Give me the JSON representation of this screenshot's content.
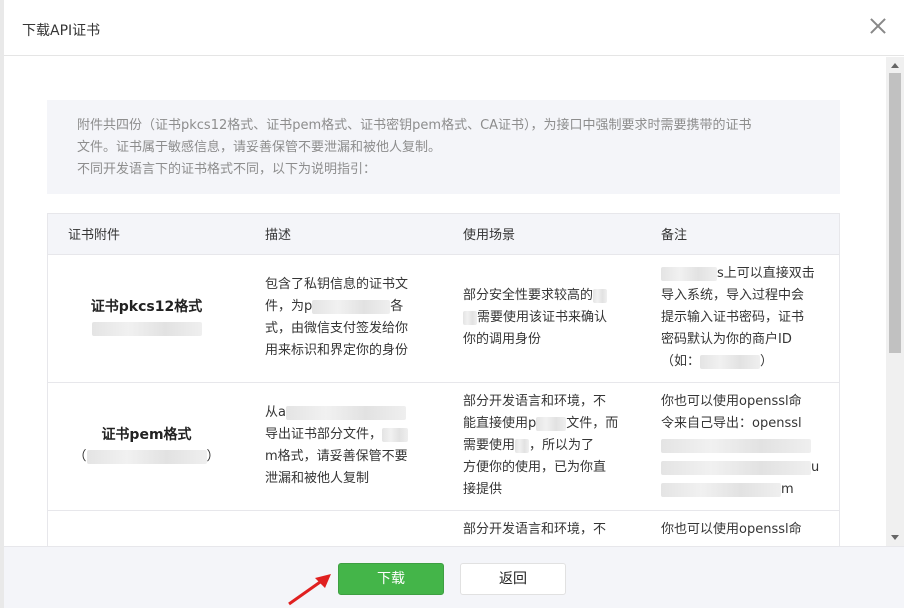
{
  "dialog": {
    "title": "下载API证书",
    "notice": {
      "line1": "附件共四份（证书pkcs12格式、证书pem格式、证书密钥pem格式、CA证书），为接口中强制要求时需要携带的证书",
      "line2": "文件。证书属于敏感信息，请妥善保管不要泄漏和被他人复制。",
      "line3": "不同开发语言下的证书格式不同，以下为说明指引："
    },
    "table": {
      "headers": [
        "证书附件",
        "描述",
        "使用场景",
        "备注"
      ],
      "rows": [
        {
          "name": "证书pkcs12格式",
          "desc": [
            "包含了私钥信息的证书文",
            "件，为p",
            "式，由微信支付签发给你",
            "用来标识和界定你的身份"
          ],
          "scene": [
            "部分安全性要求较高的",
            "需要使用该证书来确认",
            "你的调用身份"
          ],
          "note": [
            "s上可以直接双击",
            "导入系统，导入过程中会",
            "提示输入证书密码，证书",
            "密码默认为你的商户ID",
            "（如："
          ]
        },
        {
          "name": "证书pem格式",
          "desc": [
            "从a",
            "导出证书部分文件，",
            "m格式，请妥善保管不要",
            "泄漏和被他人复制"
          ],
          "scene": [
            "部分开发语言和环境，不",
            "能直接使用p",
            "文件，而",
            "需要使用",
            "，所以为了",
            "方便你的使用，已为你直",
            "接提供"
          ],
          "note": [
            "你也可以使用openssl命",
            "令来自己导出：openssl",
            "u",
            "m"
          ]
        },
        {
          "name": "",
          "desc": [],
          "scene": [
            "部分开发语言和环境，不"
          ],
          "note": [
            "你也可以使用openssl命"
          ]
        }
      ]
    },
    "footer": {
      "download_label": "下载",
      "back_label": "返回"
    }
  },
  "colors": {
    "primary": "#44b549",
    "notice_bg": "#f4f5f9",
    "arrow": "#e02020"
  }
}
